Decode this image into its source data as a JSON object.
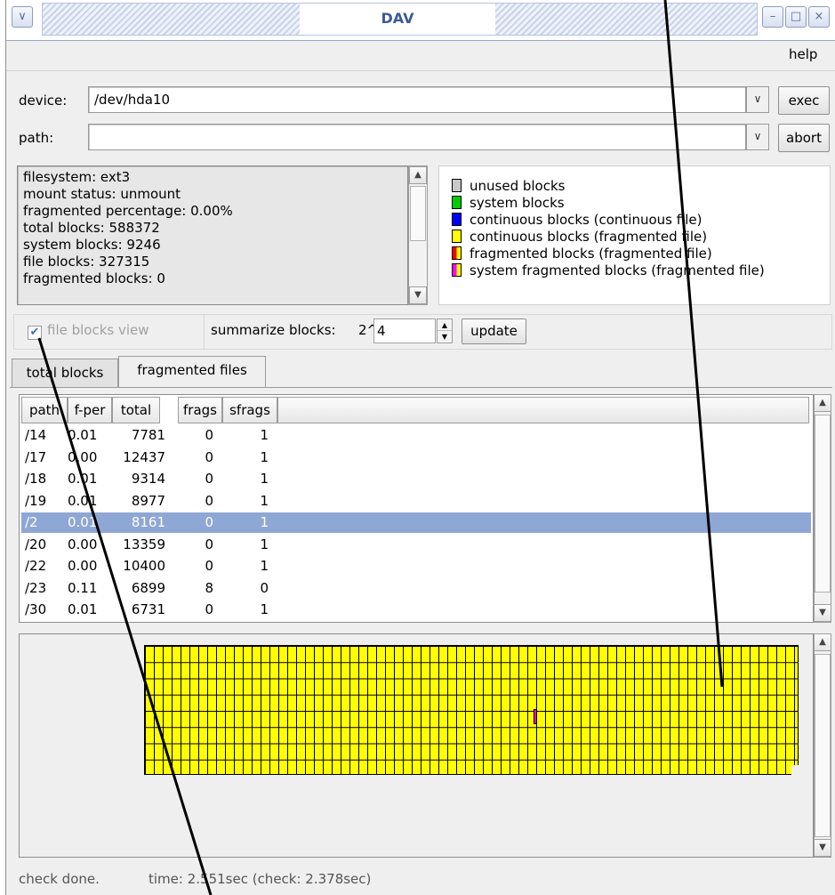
{
  "window": {
    "title": "DAV"
  },
  "menu": {
    "help": "help"
  },
  "device": {
    "label": "device:",
    "value": "/dev/hda10",
    "exec_label": "exec"
  },
  "path": {
    "label": "path:",
    "value": "",
    "abort_label": "abort"
  },
  "info": {
    "lines": [
      "filesystem: ext3",
      "mount status: unmount",
      "fragmented percentage: 0.00%",
      "total blocks: 588372",
      "system blocks: 9246",
      "file blocks: 327315",
      "fragmented blocks: 0"
    ]
  },
  "legend": {
    "items": [
      {
        "label": "unused blocks",
        "color": "#c8c8c8"
      },
      {
        "label": "system blocks",
        "color": "#00cc00"
      },
      {
        "label": "continuous blocks (continuous file)",
        "color": "#0000ff"
      },
      {
        "label": "continuous blocks (fragmented file)",
        "color": "#ffff00"
      },
      {
        "label": "fragmented blocks (fragmented file)",
        "color": "#ff0000",
        "color2": "#ffff00"
      },
      {
        "label": "system fragmented blocks (fragmented file)",
        "color": "#ff00ff",
        "color2": "#ffff00"
      }
    ]
  },
  "options": {
    "file_blocks_view": {
      "label": "file blocks view",
      "checked": true
    },
    "summarize": {
      "label": "summarize blocks:",
      "prefix": "2^",
      "value": "4"
    },
    "update_label": "update"
  },
  "tabs": [
    {
      "label": "total blocks",
      "active": false
    },
    {
      "label": "fragmented files",
      "active": true
    }
  ],
  "table": {
    "columns": [
      "path",
      "f-per",
      "total",
      "frags",
      "sfrags"
    ],
    "rows": [
      {
        "path": "/14",
        "fper": "0.01",
        "total": "7781",
        "frags": "0",
        "sfrags": "1",
        "selected": false
      },
      {
        "path": "/17",
        "fper": "0.00",
        "total": "12437",
        "frags": "0",
        "sfrags": "1",
        "selected": false
      },
      {
        "path": "/18",
        "fper": "0.01",
        "total": "9314",
        "frags": "0",
        "sfrags": "1",
        "selected": false
      },
      {
        "path": "/19",
        "fper": "0.01",
        "total": "8977",
        "frags": "0",
        "sfrags": "1",
        "selected": false
      },
      {
        "path": "/2",
        "fper": "0.01",
        "total": "8161",
        "frags": "0",
        "sfrags": "1",
        "selected": true
      },
      {
        "path": "/20",
        "fper": "0.00",
        "total": "13359",
        "frags": "0",
        "sfrags": "1",
        "selected": false
      },
      {
        "path": "/22",
        "fper": "0.00",
        "total": "10400",
        "frags": "0",
        "sfrags": "1",
        "selected": false
      },
      {
        "path": "/23",
        "fper": "0.11",
        "total": "6899",
        "frags": "8",
        "sfrags": "0",
        "selected": false
      },
      {
        "path": "/30",
        "fper": "0.01",
        "total": "6731",
        "frags": "0",
        "sfrags": "1",
        "selected": false
      }
    ]
  },
  "block_map": {
    "fill_color": "#ffff00",
    "fragment_color": "#ff00ff"
  },
  "status": {
    "state": "check done.",
    "time": "time: 2.551sec (check: 2.378sec)"
  }
}
